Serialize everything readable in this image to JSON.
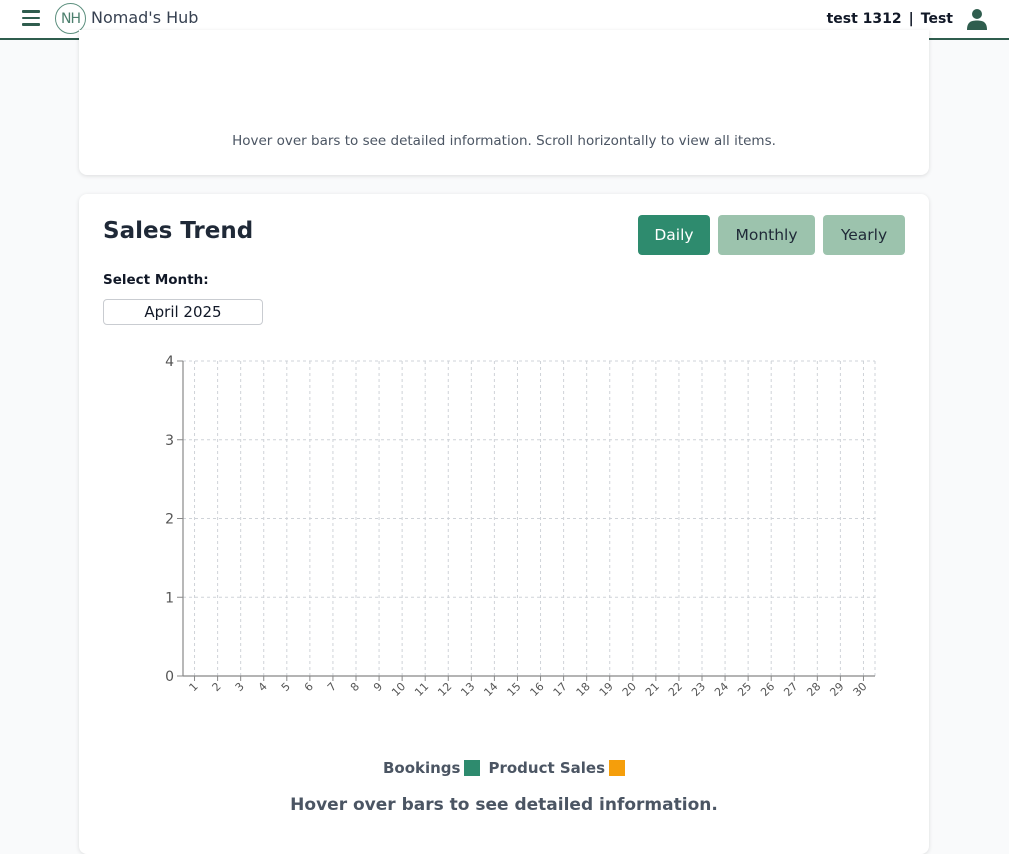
{
  "header": {
    "brand_logo": "NH",
    "brand_name": "Nomad's Hub",
    "user_name": "test 1312",
    "separator": "|",
    "user_role": "Test"
  },
  "top_card": {
    "hint": "Hover over bars to see detailed information. Scroll horizontally to view all items."
  },
  "sales": {
    "title": "Sales Trend",
    "buttons": {
      "daily": "Daily",
      "monthly": "Monthly",
      "yearly": "Yearly"
    },
    "select_label": "Select Month:",
    "selected_month": "April 2025",
    "legend": [
      {
        "label": "Bookings",
        "color": "#2e8b6e"
      },
      {
        "label": "Product Sales",
        "color": "#f59e0b"
      }
    ],
    "bottom_hint": "Hover over bars to see detailed information."
  },
  "colors": {
    "accent": "#2e8b6e",
    "inactive_button": "#9cc3ad",
    "header_line": "#2f5d4e"
  },
  "chart_data": {
    "type": "bar",
    "categories": [
      "1",
      "2",
      "3",
      "4",
      "5",
      "6",
      "7",
      "8",
      "9",
      "10",
      "11",
      "12",
      "13",
      "14",
      "15",
      "16",
      "17",
      "18",
      "19",
      "20",
      "21",
      "22",
      "23",
      "24",
      "25",
      "26",
      "27",
      "28",
      "29",
      "30"
    ],
    "series": [
      {
        "name": "Bookings",
        "values": [
          0,
          0,
          0,
          0,
          0,
          0,
          0,
          0,
          0,
          0,
          0,
          0,
          0,
          0,
          0,
          0,
          0,
          0,
          0,
          0,
          0,
          0,
          0,
          0,
          0,
          0,
          0,
          0,
          0,
          0
        ]
      },
      {
        "name": "Product Sales",
        "values": [
          0,
          0,
          0,
          0,
          0,
          0,
          0,
          0,
          0,
          0,
          0,
          0,
          0,
          0,
          0,
          0,
          0,
          0,
          0,
          0,
          0,
          0,
          0,
          0,
          0,
          0,
          0,
          0,
          0,
          0
        ]
      }
    ],
    "yticks": [
      0,
      1,
      2,
      3,
      4
    ],
    "ylim": [
      0,
      4
    ],
    "grid": true,
    "legend_position": "bottom-center"
  }
}
